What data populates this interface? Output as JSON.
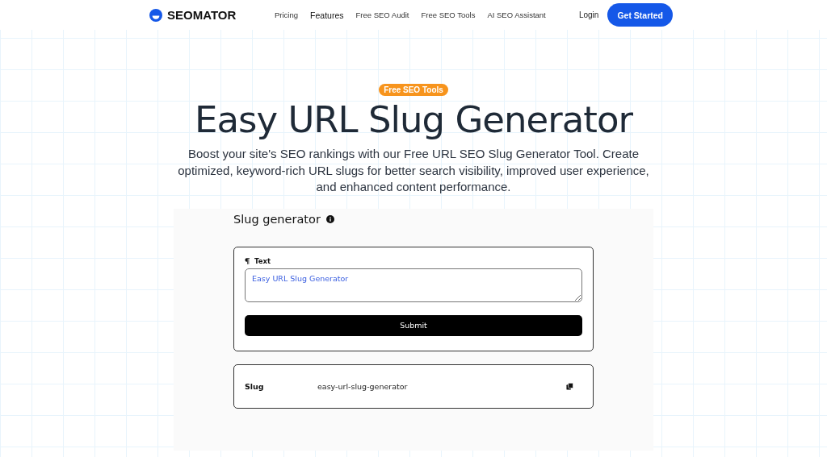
{
  "brand": {
    "name": "SEOMATOR"
  },
  "nav": [
    {
      "label": "Pricing",
      "selected": false
    },
    {
      "label": "Features",
      "selected": true
    },
    {
      "label": "Free SEO Audit",
      "selected": false
    },
    {
      "label": "Free SEO Tools",
      "selected": false
    },
    {
      "label": "AI SEO Assistant",
      "selected": false
    }
  ],
  "login": "Login",
  "cta": "Get Started",
  "hero": {
    "badge": "Free SEO Tools",
    "title": "Easy URL Slug Generator",
    "subtitle": "Boost your site's SEO rankings with our Free URL SEO Slug Generator Tool. Create optimized, keyword-rich URL slugs for better search visibility, improved user experience, and enhanced content performance."
  },
  "tool": {
    "title": "Slug generator",
    "field_label": "Text",
    "value": "Easy URL Slug Generator",
    "submit": "Submit",
    "result_label": "Slug",
    "result_value": "easy-url-slug-generator"
  }
}
